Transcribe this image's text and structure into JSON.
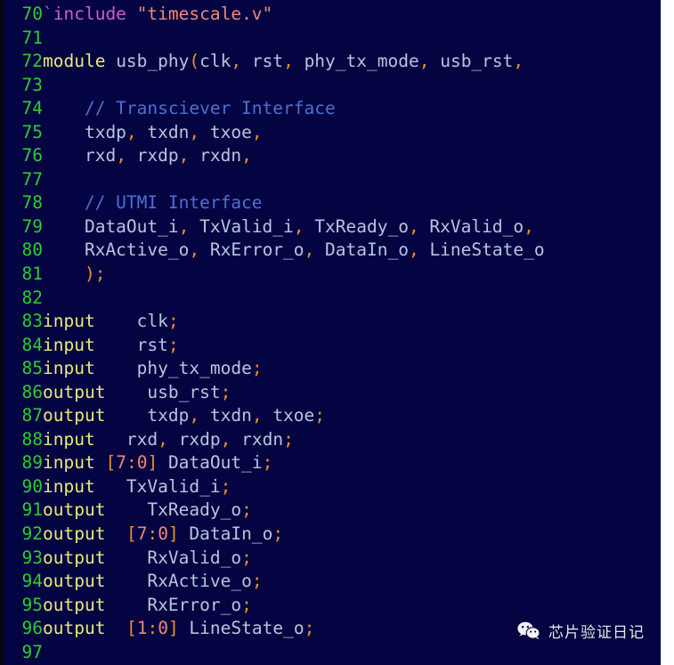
{
  "editor": {
    "background_color": "#040442",
    "gutter_color": "#2fcc2f",
    "border_color": "#08080f",
    "first_line_number": 70,
    "last_line_number": 97
  },
  "colors": {
    "keyword": "#e8e87a",
    "directive": "#cc5ecc",
    "string": "#ee8877",
    "identifier": "#b8c4dd",
    "comment": "#4d6fd4",
    "punctuation": "#e8902a",
    "number": "#ee8877",
    "line_number": "#2fcc2f",
    "background": "#040442"
  },
  "code": {
    "language": "verilog",
    "lines": [
      {
        "num": "70",
        "tokens": [
          {
            "t": "`include",
            "c": "t-dir"
          },
          {
            "t": " ",
            "c": "t-plain"
          },
          {
            "t": "\"timescale.v\"",
            "c": "t-str"
          }
        ]
      },
      {
        "num": "71",
        "tokens": []
      },
      {
        "num": "72",
        "tokens": [
          {
            "t": "module",
            "c": "t-kw"
          },
          {
            "t": " usb_phy",
            "c": "t-id"
          },
          {
            "t": "(",
            "c": "t-punc"
          },
          {
            "t": "clk",
            "c": "t-id"
          },
          {
            "t": ",",
            "c": "t-punc"
          },
          {
            "t": " rst",
            "c": "t-id"
          },
          {
            "t": ",",
            "c": "t-punc"
          },
          {
            "t": " phy_tx_mode",
            "c": "t-id"
          },
          {
            "t": ",",
            "c": "t-punc"
          },
          {
            "t": " usb_rst",
            "c": "t-id"
          },
          {
            "t": ",",
            "c": "t-punc"
          }
        ]
      },
      {
        "num": "73",
        "tokens": []
      },
      {
        "num": "74",
        "tokens": [
          {
            "t": "    // Transciever Interface",
            "c": "t-com"
          }
        ]
      },
      {
        "num": "75",
        "tokens": [
          {
            "t": "    txdp",
            "c": "t-id"
          },
          {
            "t": ",",
            "c": "t-punc"
          },
          {
            "t": " txdn",
            "c": "t-id"
          },
          {
            "t": ",",
            "c": "t-punc"
          },
          {
            "t": " txoe",
            "c": "t-id"
          },
          {
            "t": ",",
            "c": "t-punc"
          }
        ]
      },
      {
        "num": "76",
        "tokens": [
          {
            "t": "    rxd",
            "c": "t-id"
          },
          {
            "t": ",",
            "c": "t-punc"
          },
          {
            "t": " rxdp",
            "c": "t-id"
          },
          {
            "t": ",",
            "c": "t-punc"
          },
          {
            "t": " rxdn",
            "c": "t-id"
          },
          {
            "t": ",",
            "c": "t-punc"
          }
        ]
      },
      {
        "num": "77",
        "tokens": []
      },
      {
        "num": "78",
        "tokens": [
          {
            "t": "    // UTMI Interface",
            "c": "t-com"
          }
        ]
      },
      {
        "num": "79",
        "tokens": [
          {
            "t": "    DataOut_i",
            "c": "t-id"
          },
          {
            "t": ",",
            "c": "t-punc"
          },
          {
            "t": " TxValid_i",
            "c": "t-id"
          },
          {
            "t": ",",
            "c": "t-punc"
          },
          {
            "t": " TxReady_o",
            "c": "t-id"
          },
          {
            "t": ",",
            "c": "t-punc"
          },
          {
            "t": " RxValid_o",
            "c": "t-id"
          },
          {
            "t": ",",
            "c": "t-punc"
          }
        ]
      },
      {
        "num": "80",
        "tokens": [
          {
            "t": "    RxActive_o",
            "c": "t-id"
          },
          {
            "t": ",",
            "c": "t-punc"
          },
          {
            "t": " RxError_o",
            "c": "t-id"
          },
          {
            "t": ",",
            "c": "t-punc"
          },
          {
            "t": " DataIn_o",
            "c": "t-id"
          },
          {
            "t": ",",
            "c": "t-punc"
          },
          {
            "t": " LineState_o",
            "c": "t-id"
          }
        ]
      },
      {
        "num": "81",
        "tokens": [
          {
            "t": "    ",
            "c": "t-plain"
          },
          {
            "t": ");",
            "c": "t-punc"
          }
        ]
      },
      {
        "num": "82",
        "tokens": []
      },
      {
        "num": "83",
        "tokens": [
          {
            "t": "input",
            "c": "t-kw"
          },
          {
            "t": "    clk",
            "c": "t-id"
          },
          {
            "t": ";",
            "c": "t-punc"
          }
        ]
      },
      {
        "num": "84",
        "tokens": [
          {
            "t": "input",
            "c": "t-kw"
          },
          {
            "t": "    rst",
            "c": "t-id"
          },
          {
            "t": ";",
            "c": "t-punc"
          }
        ]
      },
      {
        "num": "85",
        "tokens": [
          {
            "t": "input",
            "c": "t-kw"
          },
          {
            "t": "    phy_tx_mode",
            "c": "t-id"
          },
          {
            "t": ";",
            "c": "t-punc"
          }
        ]
      },
      {
        "num": "86",
        "tokens": [
          {
            "t": "output",
            "c": "t-kw"
          },
          {
            "t": "    usb_rst",
            "c": "t-id"
          },
          {
            "t": ";",
            "c": "t-punc"
          }
        ]
      },
      {
        "num": "87",
        "tokens": [
          {
            "t": "output",
            "c": "t-kw"
          },
          {
            "t": "    txdp",
            "c": "t-id"
          },
          {
            "t": ",",
            "c": "t-punc"
          },
          {
            "t": " txdn",
            "c": "t-id"
          },
          {
            "t": ",",
            "c": "t-punc"
          },
          {
            "t": " txoe",
            "c": "t-id"
          },
          {
            "t": ";",
            "c": "t-punc"
          }
        ]
      },
      {
        "num": "88",
        "tokens": [
          {
            "t": "input",
            "c": "t-kw"
          },
          {
            "t": "   rxd",
            "c": "t-id"
          },
          {
            "t": ",",
            "c": "t-punc"
          },
          {
            "t": " rxdp",
            "c": "t-id"
          },
          {
            "t": ",",
            "c": "t-punc"
          },
          {
            "t": " rxdn",
            "c": "t-id"
          },
          {
            "t": ";",
            "c": "t-punc"
          }
        ]
      },
      {
        "num": "89",
        "tokens": [
          {
            "t": "input",
            "c": "t-kw"
          },
          {
            "t": " ",
            "c": "t-plain"
          },
          {
            "t": "[",
            "c": "t-punc"
          },
          {
            "t": "7",
            "c": "t-num"
          },
          {
            "t": ":",
            "c": "t-punc"
          },
          {
            "t": "0",
            "c": "t-num"
          },
          {
            "t": "]",
            "c": "t-punc"
          },
          {
            "t": " DataOut_i",
            "c": "t-id"
          },
          {
            "t": ";",
            "c": "t-punc"
          }
        ]
      },
      {
        "num": "90",
        "tokens": [
          {
            "t": "input",
            "c": "t-kw"
          },
          {
            "t": "   TxValid_i",
            "c": "t-id"
          },
          {
            "t": ";",
            "c": "t-punc"
          }
        ]
      },
      {
        "num": "91",
        "tokens": [
          {
            "t": "output",
            "c": "t-kw"
          },
          {
            "t": "    TxReady_o",
            "c": "t-id"
          },
          {
            "t": ";",
            "c": "t-punc"
          }
        ]
      },
      {
        "num": "92",
        "tokens": [
          {
            "t": "output",
            "c": "t-kw"
          },
          {
            "t": "  ",
            "c": "t-plain"
          },
          {
            "t": "[",
            "c": "t-punc"
          },
          {
            "t": "7",
            "c": "t-num"
          },
          {
            "t": ":",
            "c": "t-punc"
          },
          {
            "t": "0",
            "c": "t-num"
          },
          {
            "t": "]",
            "c": "t-punc"
          },
          {
            "t": " DataIn_o",
            "c": "t-id"
          },
          {
            "t": ";",
            "c": "t-punc"
          }
        ]
      },
      {
        "num": "93",
        "tokens": [
          {
            "t": "output",
            "c": "t-kw"
          },
          {
            "t": "    RxValid_o",
            "c": "t-id"
          },
          {
            "t": ";",
            "c": "t-punc"
          }
        ]
      },
      {
        "num": "94",
        "tokens": [
          {
            "t": "output",
            "c": "t-kw"
          },
          {
            "t": "    RxActive_o",
            "c": "t-id"
          },
          {
            "t": ";",
            "c": "t-punc"
          }
        ]
      },
      {
        "num": "95",
        "tokens": [
          {
            "t": "output",
            "c": "t-kw"
          },
          {
            "t": "    RxError_o",
            "c": "t-id"
          },
          {
            "t": ";",
            "c": "t-punc"
          }
        ]
      },
      {
        "num": "96",
        "tokens": [
          {
            "t": "output",
            "c": "t-kw"
          },
          {
            "t": "  ",
            "c": "t-plain"
          },
          {
            "t": "[",
            "c": "t-punc"
          },
          {
            "t": "1",
            "c": "t-num"
          },
          {
            "t": ":",
            "c": "t-punc"
          },
          {
            "t": "0",
            "c": "t-num"
          },
          {
            "t": "]",
            "c": "t-punc"
          },
          {
            "t": " LineState_o",
            "c": "t-id"
          },
          {
            "t": ";",
            "c": "t-punc"
          }
        ]
      },
      {
        "num": "97",
        "tokens": []
      }
    ]
  },
  "watermark": {
    "icon": "wechat-icon",
    "text": "芯片验证日记",
    "text_color": "#f2f2f2"
  }
}
